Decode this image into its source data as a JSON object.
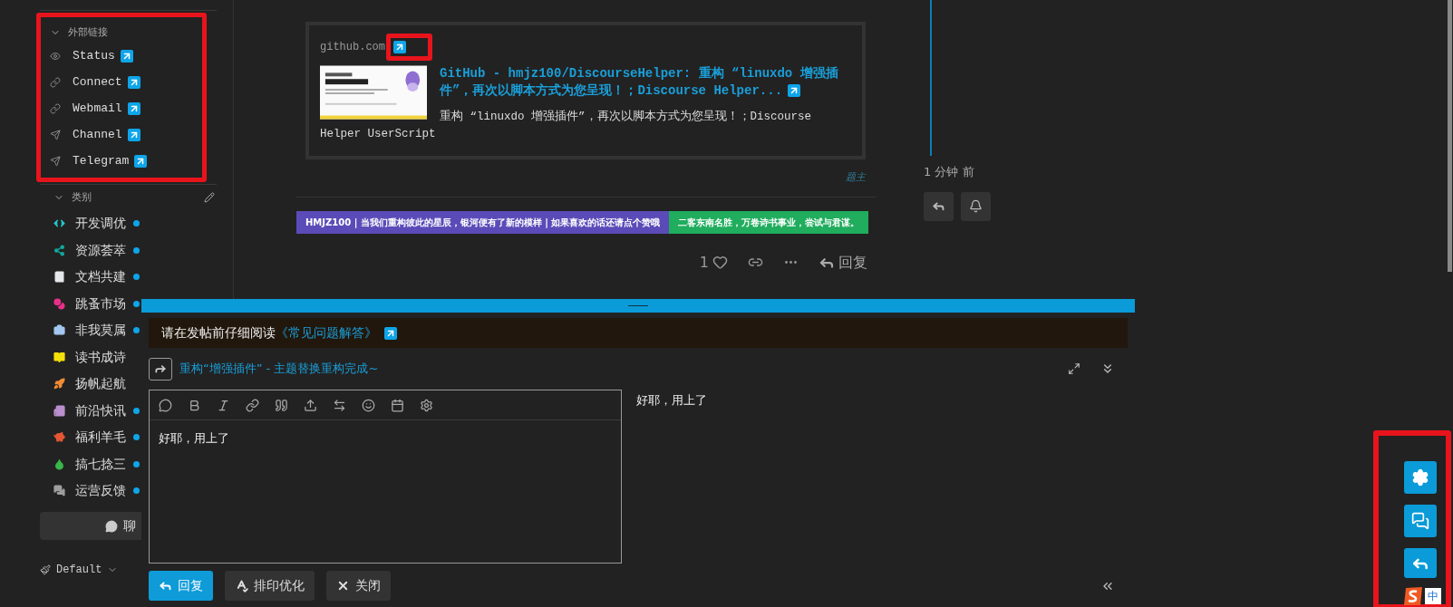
{
  "sidebar": {
    "external_links": {
      "title": "外部链接",
      "expanded": true,
      "highlighted": true,
      "items": [
        {
          "label": "Status"
        },
        {
          "label": "Connect"
        },
        {
          "label": "Webmail"
        },
        {
          "label": "Channel"
        },
        {
          "label": "Telegram"
        }
      ]
    },
    "categories": {
      "title": "类别",
      "expanded": true,
      "items": [
        {
          "label": "开发调优",
          "color": "#25c5c8",
          "unread": true
        },
        {
          "label": "资源荟萃",
          "color": "#12a89d",
          "unread": true
        },
        {
          "label": "文档共建",
          "color": "#e5e7eb",
          "unread": true
        },
        {
          "label": "跳蚤市场",
          "color": "#e9308a",
          "unread": true
        },
        {
          "label": "非我莫属",
          "color": "#a3c7f0",
          "unread": true
        },
        {
          "label": "读书成诗",
          "color": "#f5e10a",
          "unread": false
        },
        {
          "label": "扬帆起航",
          "color": "#f08c35",
          "unread": false
        },
        {
          "label": "前沿快讯",
          "color": "#bb8fce",
          "unread": true
        },
        {
          "label": "福利羊毛",
          "color": "#e45735",
          "unread": true
        },
        {
          "label": "搞七捻三",
          "color": "#3ab54a",
          "unread": true
        },
        {
          "label": "运营反馈",
          "color": "#9e9e9e",
          "unread": true
        }
      ]
    },
    "chat_button": {
      "label": "聊"
    },
    "theme_selector": {
      "label": "Default"
    }
  },
  "post": {
    "onebox": {
      "domain": "github.com",
      "domain_highlighted": true,
      "title": "GitHub - hmjz100/DiscourseHelper: 重构 “linuxdo 增强插件”，再次以脚本方式为您呈现！；Discourse Helper...",
      "description": "重构 “linuxdo 增强插件”，再次以脚本方式为您呈现！；Discourse Helper UserScript"
    },
    "author_badge": "题主",
    "signature": [
      {
        "text": "HMJZ100 | 当我们重构彼此的星辰，银河便有了新的模样 | 如果喜欢的话还请点个赞哦",
        "color": "#5b4bb8"
      },
      {
        "text": "二客东南名胜，万卷诗书事业，尝试与君谋。",
        "color": "#20ad5d"
      }
    ],
    "like_count": "1",
    "reply_label": "回复"
  },
  "timeline": {
    "time": "1 分钟 前"
  },
  "composer": {
    "notice": "请在发帖前仔细阅读",
    "notice_link": "《常见问题解答》",
    "reply_to": "重构“增强插件” - 主题替换重构完成~",
    "text": "好耶，用上了",
    "preview": "好耶，用上了",
    "buttons": [
      {
        "kind": "primary",
        "label": "回复"
      },
      {
        "kind": "typography",
        "label": "排印优化"
      },
      {
        "kind": "close",
        "label": "关闭"
      }
    ]
  },
  "floating_actions": {
    "highlighted": true
  },
  "ime_indicator": {
    "label": "中"
  }
}
